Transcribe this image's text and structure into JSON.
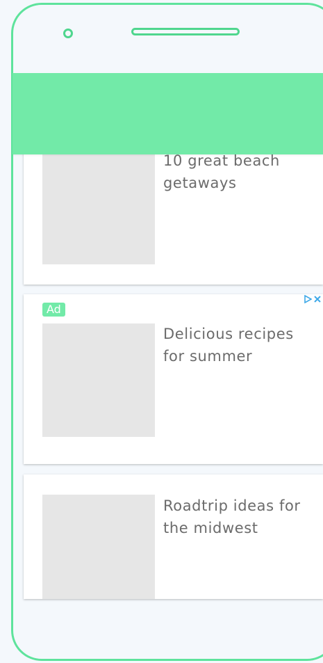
{
  "colors": {
    "frame": "#5ee39c",
    "app_bar": "#72eaa8",
    "thumbnail": "#e6e6e6",
    "title_text": "#6b6b6b",
    "adchoices": "#3fa9e8"
  },
  "feed": {
    "items": [
      {
        "title": "10 great beach getaways",
        "is_ad": false
      },
      {
        "title": "Delicious recipes for summer",
        "is_ad": true,
        "ad_label": "Ad"
      },
      {
        "title": "Roadtrip ideas for the midwest",
        "is_ad": false
      }
    ]
  },
  "icons": {
    "adchoices_play": "adchoices-icon",
    "adchoices_close": "close-icon"
  }
}
